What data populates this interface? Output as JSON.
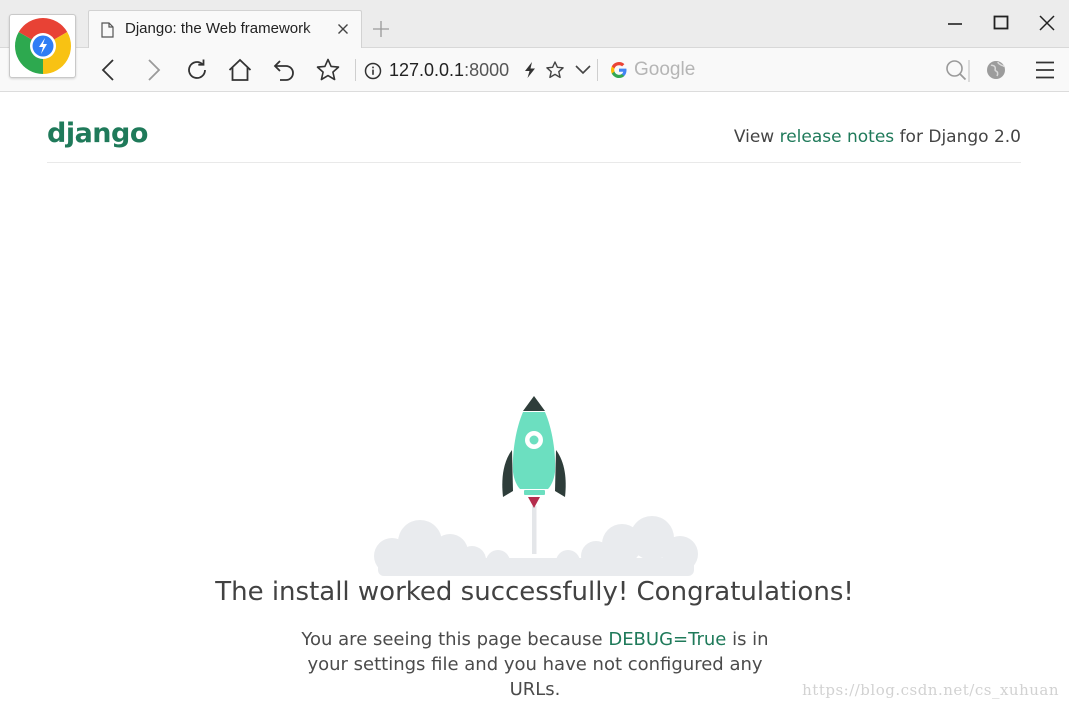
{
  "browser": {
    "tab": {
      "title": "Django: the Web framework"
    },
    "address": {
      "host": "127.0.0.1",
      "port": ":8000"
    },
    "search": {
      "placeholder": "Google"
    }
  },
  "page": {
    "logo": "django",
    "release": {
      "prefix": "View ",
      "link": "release notes",
      "suffix": " for Django 2.0"
    },
    "headline": "The install worked successfully! Congratulations!",
    "subtext": {
      "before": "You are seeing this page because ",
      "highlight": "DEBUG=True",
      "after": " is in your settings file and you have not configured any URLs."
    }
  },
  "watermark": "https://blog.csdn.net/cs_xuhuan",
  "colors": {
    "django_green": "#1f7a5a",
    "rocket_body": "#6cdfc0",
    "rocket_dark": "#2e3d3a",
    "flame": "#b52d4d",
    "cloud": "#e9ebee"
  },
  "icons": {
    "tab_page": "document-icon",
    "tab_close": "close-icon",
    "new_tab": "plus-icon",
    "nav": [
      "back-icon",
      "forward-icon",
      "reload-icon",
      "home-icon",
      "undo-icon",
      "favorite-icon"
    ],
    "address": [
      "info-icon",
      "bolt-icon",
      "star-icon",
      "chevron-down-icon"
    ],
    "right": [
      "search-icon",
      "globe-icon",
      "menu-icon"
    ]
  }
}
